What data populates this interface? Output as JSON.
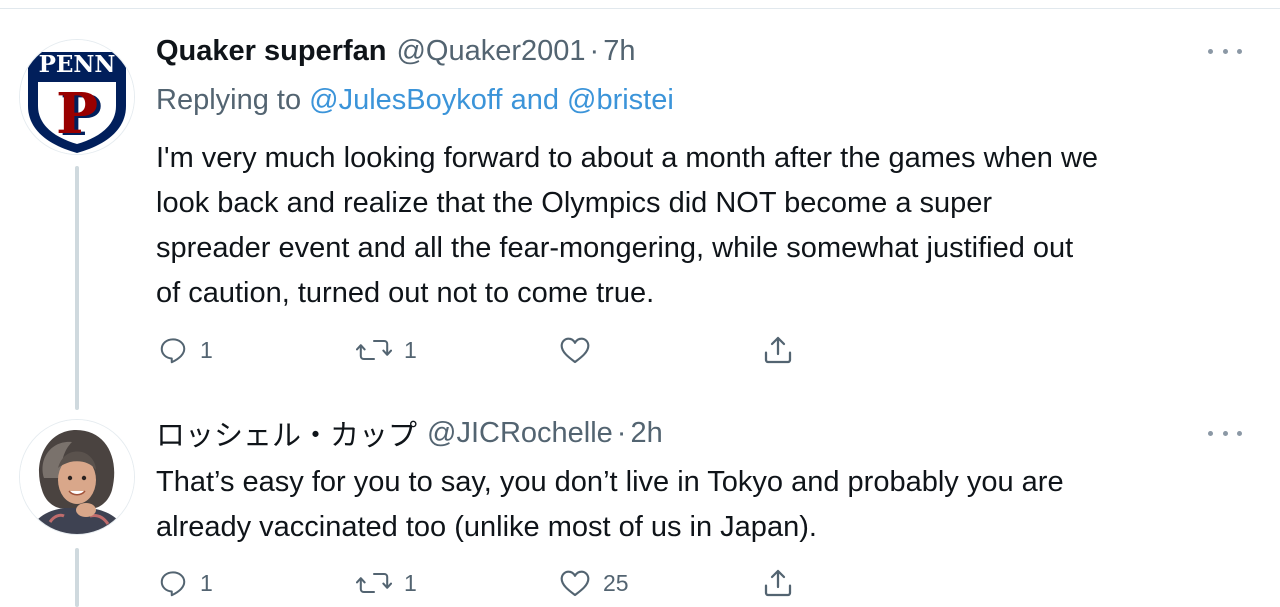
{
  "tweets": [
    {
      "name": "Quaker superfan",
      "handle": "@Quaker2001",
      "separator": "·",
      "time": "7h",
      "avatar_logo_text": "PENN",
      "avatar_logo_letter": "P",
      "reply_prefix": "Replying to",
      "reply_mention_1": "@JulesBoykoff",
      "reply_and": "and",
      "reply_mention_2": "@bristei",
      "text_lines": [
        "I'm very much looking forward to about a month after the games when we",
        "look back and realize that the Olympics did NOT become a super",
        "spreader event and all the fear-mongering, while somewhat justified out",
        "of caution, turned out not to come true."
      ],
      "reply_count": "1",
      "retweet_count": "1",
      "like_count": ""
    },
    {
      "name": "ロッシェル・カップ",
      "handle": "@JICRochelle",
      "separator": "·",
      "time": "2h",
      "text_lines": [
        "That’s easy for you to say, you don’t live in Tokyo and probably you are",
        "already vaccinated too (unlike most of us in Japan)."
      ],
      "reply_count": "1",
      "retweet_count": "1",
      "like_count": "25"
    }
  ],
  "icons": {
    "reply": "reply-icon",
    "retweet": "retweet-icon",
    "like": "heart-icon",
    "share": "share-icon",
    "more": "more-icon"
  },
  "colors": {
    "link": "#3b94d9",
    "secondary_text": "#536471",
    "icon": "#536471",
    "thread_line": "#cfd9de",
    "penn_navy": "#011f5b",
    "penn_red": "#990000"
  }
}
